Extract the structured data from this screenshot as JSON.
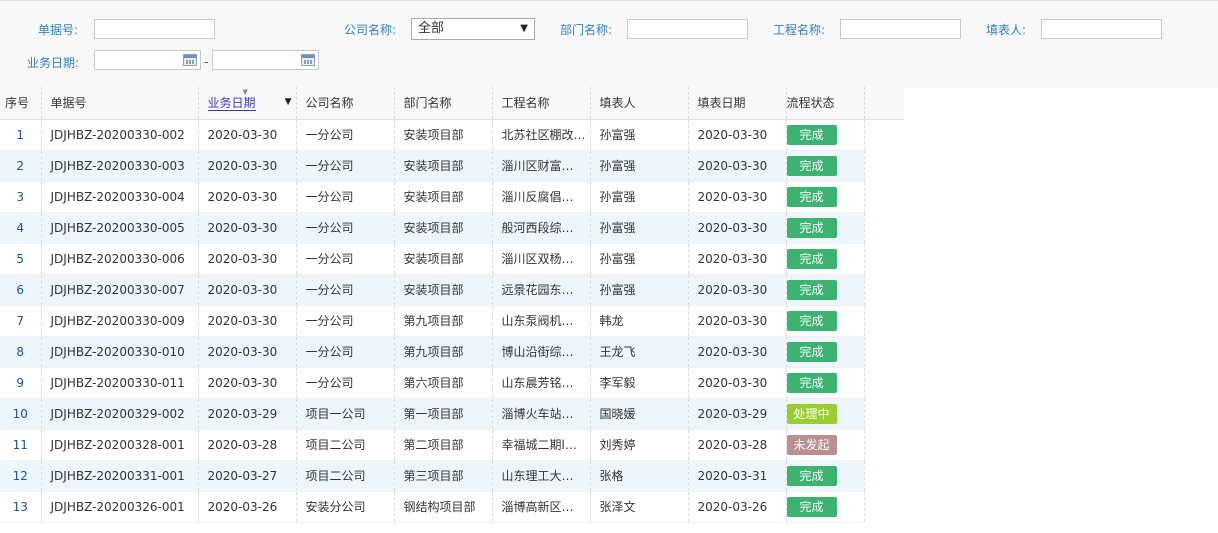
{
  "filters": {
    "bill_no_label": "单据号:",
    "bill_no_value": "",
    "company_label": "公司名称:",
    "company_selected": "全部",
    "dept_label": "部门名称:",
    "dept_value": "",
    "project_label": "工程名称:",
    "project_value": "",
    "filler_label": "填表人:",
    "filler_value": "",
    "biz_date_label": "业务日期:",
    "date_from": "",
    "date_to": "",
    "date_separator": "-"
  },
  "table": {
    "columns": [
      "序号",
      "单据号",
      "业务日期",
      "公司名称",
      "部门名称",
      "工程名称",
      "填表人",
      "填表日期",
      "流程状态"
    ],
    "rows": [
      {
        "idx": "1",
        "bill": "JDJHBZ-20200330-002",
        "biz_date": "2020-03-30",
        "company": "一分公司",
        "dept": "安装项目部",
        "project": "北苏社区棚改…",
        "filler": "孙富强",
        "fill_date": "2020-03-30",
        "status": "完成"
      },
      {
        "idx": "2",
        "bill": "JDJHBZ-20200330-003",
        "biz_date": "2020-03-30",
        "company": "一分公司",
        "dept": "安装项目部",
        "project": "淄川区财富…",
        "filler": "孙富强",
        "fill_date": "2020-03-30",
        "status": "完成"
      },
      {
        "idx": "3",
        "bill": "JDJHBZ-20200330-004",
        "biz_date": "2020-03-30",
        "company": "一分公司",
        "dept": "安装项目部",
        "project": "淄川反腐倡…",
        "filler": "孙富强",
        "fill_date": "2020-03-30",
        "status": "完成"
      },
      {
        "idx": "4",
        "bill": "JDJHBZ-20200330-005",
        "biz_date": "2020-03-30",
        "company": "一分公司",
        "dept": "安装项目部",
        "project": "般河西段综…",
        "filler": "孙富强",
        "fill_date": "2020-03-30",
        "status": "完成"
      },
      {
        "idx": "5",
        "bill": "JDJHBZ-20200330-006",
        "biz_date": "2020-03-30",
        "company": "一分公司",
        "dept": "安装项目部",
        "project": "淄川区双杨…",
        "filler": "孙富强",
        "fill_date": "2020-03-30",
        "status": "完成"
      },
      {
        "idx": "6",
        "bill": "JDJHBZ-20200330-007",
        "biz_date": "2020-03-30",
        "company": "一分公司",
        "dept": "安装项目部",
        "project": "远景花园东…",
        "filler": "孙富强",
        "fill_date": "2020-03-30",
        "status": "完成"
      },
      {
        "idx": "7",
        "bill": "JDJHBZ-20200330-009",
        "biz_date": "2020-03-30",
        "company": "一分公司",
        "dept": "第九项目部",
        "project": "山东泵阀机…",
        "filler": "韩龙",
        "fill_date": "2020-03-30",
        "status": "完成"
      },
      {
        "idx": "8",
        "bill": "JDJHBZ-20200330-010",
        "biz_date": "2020-03-30",
        "company": "一分公司",
        "dept": "第九项目部",
        "project": "博山沿街综…",
        "filler": "王龙飞",
        "fill_date": "2020-03-30",
        "status": "完成"
      },
      {
        "idx": "9",
        "bill": "JDJHBZ-20200330-011",
        "biz_date": "2020-03-30",
        "company": "一分公司",
        "dept": "第六项目部",
        "project": "山东晨芳铭…",
        "filler": "李军毅",
        "fill_date": "2020-03-30",
        "status": "完成"
      },
      {
        "idx": "10",
        "bill": "JDJHBZ-20200329-002",
        "biz_date": "2020-03-29",
        "company": "项目一公司",
        "dept": "第一项目部",
        "project": "淄博火车站…",
        "filler": "国晓媛",
        "fill_date": "2020-03-29",
        "status": "处理中"
      },
      {
        "idx": "11",
        "bill": "JDJHBZ-20200328-001",
        "biz_date": "2020-03-28",
        "company": "项目二公司",
        "dept": "第二项目部",
        "project": "幸福城二期l…",
        "filler": "刘秀婷",
        "fill_date": "2020-03-28",
        "status": "未发起"
      },
      {
        "idx": "12",
        "bill": "JDJHBZ-20200331-001",
        "biz_date": "2020-03-27",
        "company": "项目二公司",
        "dept": "第三项目部",
        "project": "山东理工大…",
        "filler": "张格",
        "fill_date": "2020-03-31",
        "status": "完成"
      },
      {
        "idx": "13",
        "bill": "JDJHBZ-20200326-001",
        "biz_date": "2020-03-26",
        "company": "安装分公司",
        "dept": "钢结构项目部",
        "project": "淄博高新区…",
        "filler": "张泽文",
        "fill_date": "2020-03-26",
        "status": "完成"
      }
    ]
  },
  "status_colors": {
    "完成": "#3cb371",
    "处理中": "#9acd32",
    "未发起": "#bc8f8f"
  }
}
